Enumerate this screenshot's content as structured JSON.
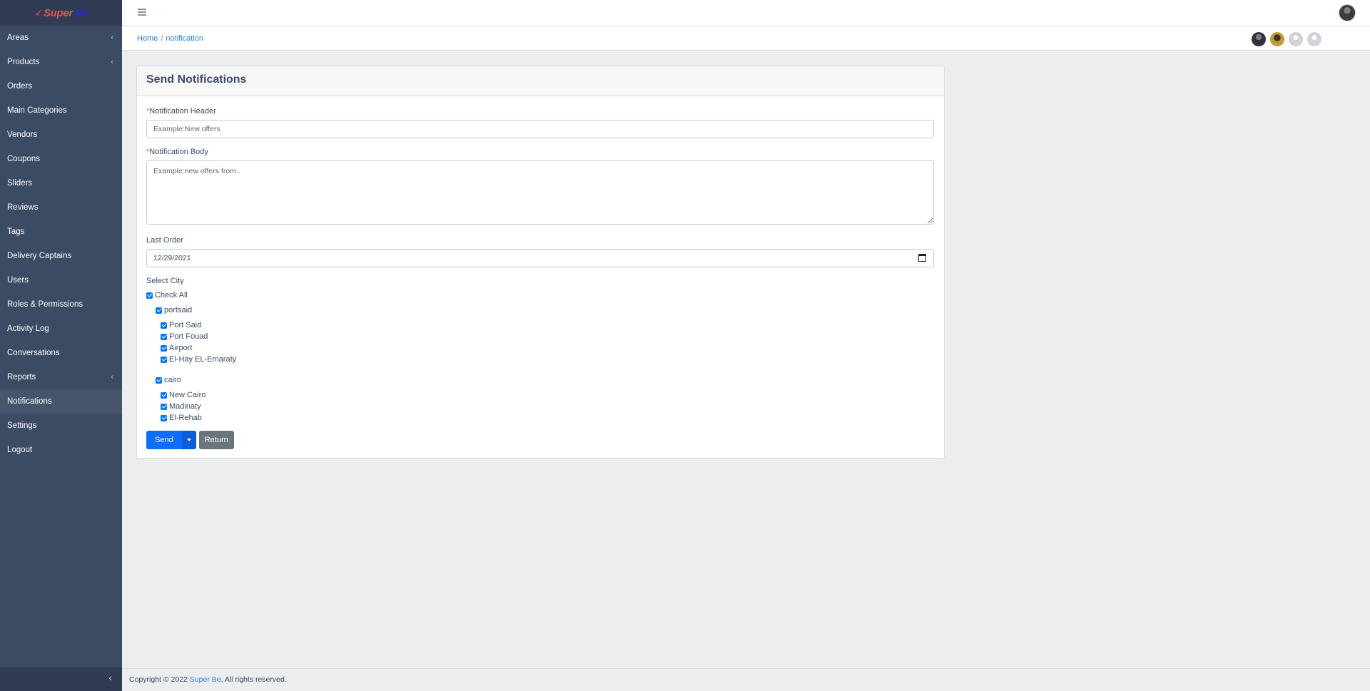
{
  "brand": {
    "part1": "Super",
    "part2": "Be"
  },
  "sidebar": {
    "items": [
      {
        "label": "Areas",
        "has_children": true
      },
      {
        "label": "Products",
        "has_children": true
      },
      {
        "label": "Orders"
      },
      {
        "label": "Main Categories"
      },
      {
        "label": "Vendors"
      },
      {
        "label": "Coupons"
      },
      {
        "label": "Sliders"
      },
      {
        "label": "Reviews"
      },
      {
        "label": "Tags"
      },
      {
        "label": "Delivery Captains"
      },
      {
        "label": "Users"
      },
      {
        "label": "Roles & Permissions"
      },
      {
        "label": "Activity Log"
      },
      {
        "label": "Conversations"
      },
      {
        "label": "Reports",
        "has_children": true
      },
      {
        "label": "Notifications",
        "active": true
      },
      {
        "label": "Settings"
      },
      {
        "label": "Logout"
      }
    ]
  },
  "breadcrumb": {
    "home": "Home",
    "separator": "/",
    "current": "notification"
  },
  "card": {
    "title": "Send Notifications",
    "header_field": {
      "required_mark": "*",
      "label": "Notification Header",
      "placeholder": "Example:New offers"
    },
    "body_field": {
      "required_mark": "*",
      "label": "Notification Body",
      "placeholder": "Example:new offers from.."
    },
    "last_order": {
      "label": "Last Order",
      "value": "12/29/2021"
    },
    "select_city": {
      "label": "Select City",
      "check_all": "Check All",
      "cities": [
        {
          "name": "portsaid",
          "areas": [
            "Port Said",
            "Port Fouad",
            "Airport",
            "El-Hay EL-Emaraty"
          ]
        },
        {
          "name": "cairo",
          "areas": [
            "New Cairo",
            "Madinaty",
            "El-Rehab"
          ]
        }
      ]
    },
    "send_label": "Send",
    "return_label": "Return"
  },
  "footer": {
    "prefix": "Copyright © 2022 ",
    "brand": "Super Be",
    "suffix": ", All rights reserved."
  },
  "colors": {
    "sidebar": "#3c4b64",
    "primary": "#0d6efd",
    "secondary": "#6c757d",
    "link": "#2d7be5",
    "required": "#e55353"
  }
}
